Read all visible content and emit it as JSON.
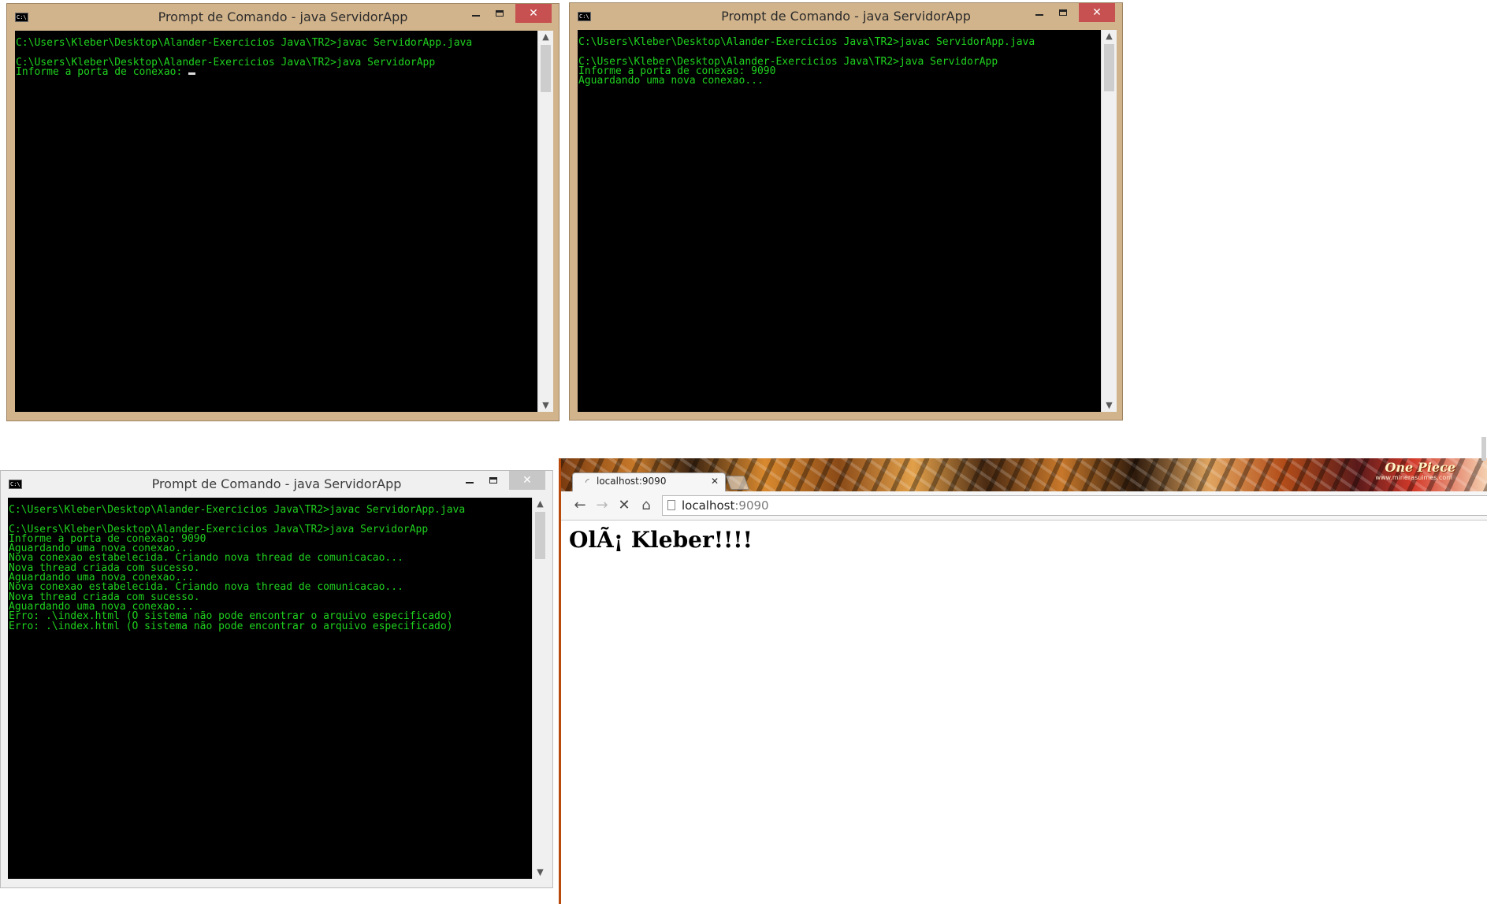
{
  "windows": [
    {
      "title": "Prompt de Comando - java  ServidorApp",
      "lines": [
        "C:\\Users\\Kleber\\Desktop\\Alander-Exercicios Java\\TR2>javac ServidorApp.java",
        "",
        "C:\\Users\\Kleber\\Desktop\\Alander-Exercicios Java\\TR2>java ServidorApp",
        "Informe a porta de conexao: "
      ]
    },
    {
      "title": "Prompt de Comando - java  ServidorApp",
      "lines": [
        "C:\\Users\\Kleber\\Desktop\\Alander-Exercicios Java\\TR2>javac ServidorApp.java",
        "",
        "C:\\Users\\Kleber\\Desktop\\Alander-Exercicios Java\\TR2>java ServidorApp",
        "Informe a porta de conexao: 9090",
        "Aguardando uma nova conexao..."
      ]
    },
    {
      "title": "Prompt de Comando - java  ServidorApp",
      "lines": [
        "C:\\Users\\Kleber\\Desktop\\Alander-Exercicios Java\\TR2>javac ServidorApp.java",
        "",
        "C:\\Users\\Kleber\\Desktop\\Alander-Exercicios Java\\TR2>java ServidorApp",
        "Informe a porta de conexao: 9090",
        "Aguardando uma nova conexao...",
        "Nova conexao estabelecida. Criando nova thread de comunicacao...",
        "Nova thread criada com sucesso.",
        "Aguardando uma nova conexao...",
        "Nova conexao estabelecida. Criando nova thread de comunicacao...",
        "Nova thread criada com sucesso.",
        "Aguardando uma nova conexao...",
        "Erro: .\\index.html (O sistema não pode encontrar o arquivo especificado)",
        "Erro: .\\index.html (O sistema não pode encontrar o arquivo especificado)"
      ]
    }
  ],
  "icons": {
    "console": "cmd-console-icon",
    "minimize": "minimize-icon",
    "maximize": "maximize-icon",
    "close": "close-icon",
    "scroll_up": "scroll-up-arrow-icon",
    "scroll_down": "scroll-down-arrow-icon",
    "tab_favicon": "loading-spinner-icon",
    "back": "back-arrow-icon",
    "forward": "forward-arrow-icon",
    "stop": "stop-icon",
    "home": "home-icon",
    "page": "page-icon"
  },
  "window_controls": {
    "minimize_glyph": "–",
    "close_glyph": "✕"
  },
  "browser": {
    "tab_title": "localhost:9090",
    "tab_close_glyph": "✕",
    "url_host": "localhost",
    "url_port": ":9090",
    "theme_logo": "One Piece",
    "theme_logo_sub": "www.minerasuimes.com",
    "page_heading": "OlÃ¡ Kleber!!!!",
    "nav_back_glyph": "←",
    "nav_forward_glyph": "→",
    "nav_stop_glyph": "✕",
    "nav_home_glyph": "⌂"
  },
  "colors": {
    "active_frame": "#d2b48c",
    "inactive_frame": "#f0f0f0",
    "console_bg": "#000000",
    "console_text": "#1fd11f",
    "close_button": "#c75050",
    "browser_accent": "#b84a0c"
  }
}
